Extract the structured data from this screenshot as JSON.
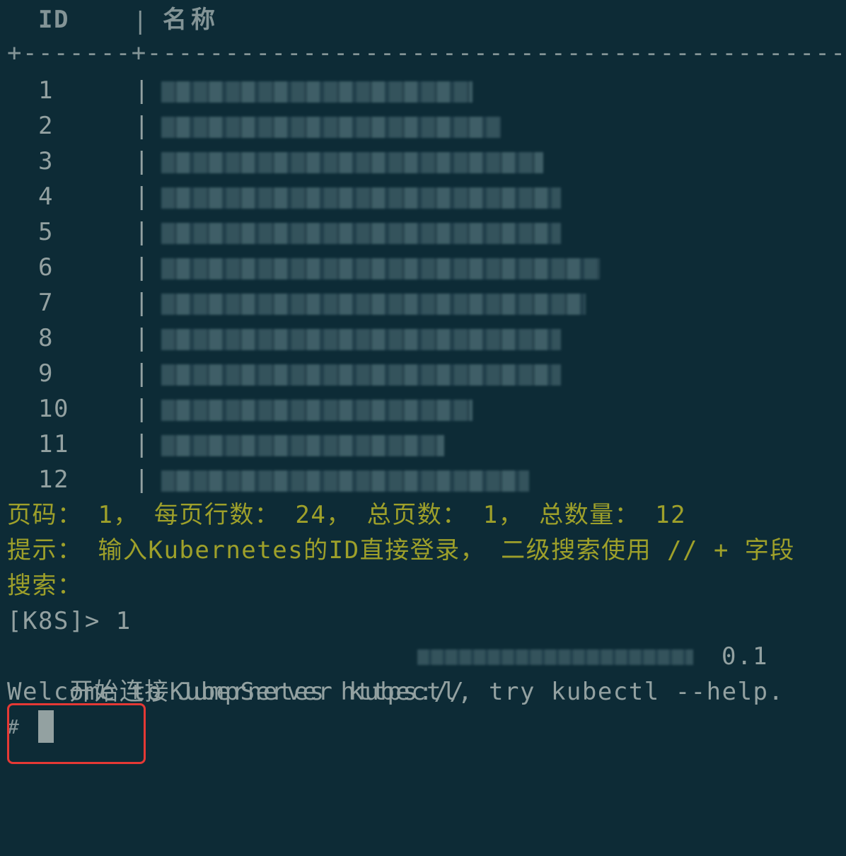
{
  "table": {
    "header_id": "ID",
    "header_sep": "|",
    "header_name": "名称",
    "divider": "+-------+----------------------------------------------------------------------------------------",
    "rows": [
      {
        "id": "1"
      },
      {
        "id": "2"
      },
      {
        "id": "3"
      },
      {
        "id": "4"
      },
      {
        "id": "5"
      },
      {
        "id": "6"
      },
      {
        "id": "7"
      },
      {
        "id": "8"
      },
      {
        "id": "9"
      },
      {
        "id": "10"
      },
      {
        "id": "11"
      },
      {
        "id": "12"
      }
    ],
    "row_sep": "|"
  },
  "pagination": "页码： 1， 每页行数： 24， 总页数： 1， 总数量： 12",
  "hint": "提示： 输入Kubernetes的ID直接登录， 二级搜索使用 // + 字段",
  "search_prompt": "搜索：",
  "command_line": "[K8S]> 1",
  "connect_prefix": "开始连接Kubernetes https://",
  "connect_suffix": "0.1",
  "welcome": "Welcome to JumpServer kubectl, try kubectl --help.",
  "shell_prompt": "#",
  "colors": {
    "background": "#0d2b36",
    "text": "#93a1a1",
    "yellow": "#9ea02a",
    "highlight": "#e53935"
  }
}
